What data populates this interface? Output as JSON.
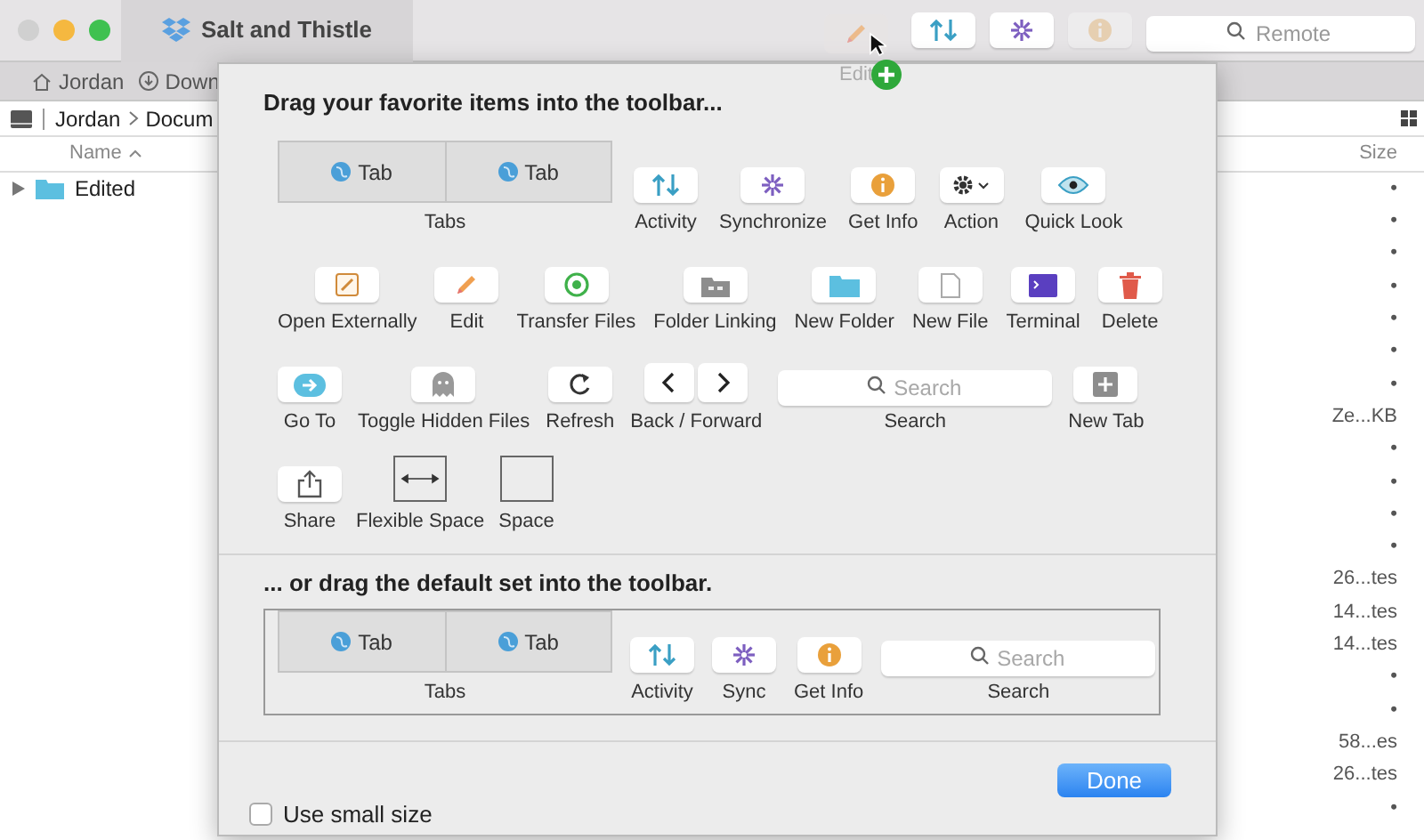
{
  "window": {
    "tab_title": "Salt and Thistle"
  },
  "toolbar": {
    "buttons": [
      {
        "disabled": false
      },
      {
        "disabled": false
      },
      {
        "disabled": true
      }
    ],
    "search_placeholder": "Remote"
  },
  "dragged_item": {
    "label": "Edit"
  },
  "favorites_bar": [
    {
      "label": "Jordan"
    },
    {
      "label": "Down"
    }
  ],
  "path_bar": [
    "Jordan",
    "Docum"
  ],
  "file_list": {
    "columns": [
      "Name",
      "Size"
    ],
    "rows": [
      {
        "name": "Edited",
        "size": "•"
      },
      {
        "size": "•"
      },
      {
        "size": "•"
      },
      {
        "size": "•"
      },
      {
        "size": "•"
      },
      {
        "size": "•"
      },
      {
        "size": "•"
      },
      {
        "size": "Ze...KB"
      },
      {
        "size": "•"
      },
      {
        "size": "•"
      },
      {
        "size": "•"
      },
      {
        "size": "•"
      },
      {
        "size": "26...tes"
      },
      {
        "size": "14...tes"
      },
      {
        "size": "14...tes"
      },
      {
        "size": "•"
      },
      {
        "size": "•"
      },
      {
        "size": "58...es"
      },
      {
        "size": "26...tes"
      },
      {
        "size": "•"
      }
    ]
  },
  "sheet": {
    "title": "Drag your favorite items into the toolbar...",
    "palette_rows": [
      [
        {
          "kind": "tabs",
          "tabs": [
            "Tab",
            "Tab"
          ],
          "label": "Tabs"
        },
        {
          "kind": "button",
          "label": "Activity"
        },
        {
          "kind": "button",
          "label": "Synchronize"
        },
        {
          "kind": "button",
          "label": "Get Info"
        },
        {
          "kind": "button",
          "label": "Action"
        },
        {
          "kind": "button",
          "label": "Quick Look"
        }
      ],
      [
        {
          "kind": "button",
          "label": "Open Externally"
        },
        {
          "kind": "button",
          "label": "Edit"
        },
        {
          "kind": "button",
          "label": "Transfer Files"
        },
        {
          "kind": "button",
          "label": "Folder Linking"
        },
        {
          "kind": "button",
          "label": "New Folder"
        },
        {
          "kind": "button",
          "label": "New File"
        },
        {
          "kind": "button",
          "label": "Terminal"
        },
        {
          "kind": "button",
          "label": "Delete"
        }
      ],
      [
        {
          "kind": "button",
          "label": "Go To"
        },
        {
          "kind": "button",
          "label": "Toggle Hidden Files"
        },
        {
          "kind": "button",
          "label": "Refresh"
        },
        {
          "kind": "segmented",
          "label": "Back / Forward"
        },
        {
          "kind": "search",
          "placeholder": "Search",
          "label": "Search"
        },
        {
          "kind": "button",
          "label": "New Tab"
        }
      ],
      [
        {
          "kind": "button",
          "label": "Share"
        },
        {
          "kind": "flex_space",
          "label": "Flexible Space"
        },
        {
          "kind": "space",
          "label": "Space"
        }
      ]
    ],
    "default_title": "... or drag the default set into the toolbar.",
    "default_set": [
      {
        "kind": "tabs",
        "tabs": [
          "Tab",
          "Tab"
        ],
        "label": "Tabs"
      },
      {
        "kind": "button",
        "label": "Activity"
      },
      {
        "kind": "button",
        "label": "Sync"
      },
      {
        "kind": "button",
        "label": "Get Info"
      },
      {
        "kind": "search",
        "placeholder": "Search",
        "label": "Search"
      }
    ],
    "small_size": {
      "label": "Use small size",
      "checked": false
    },
    "done_button": "Done"
  }
}
